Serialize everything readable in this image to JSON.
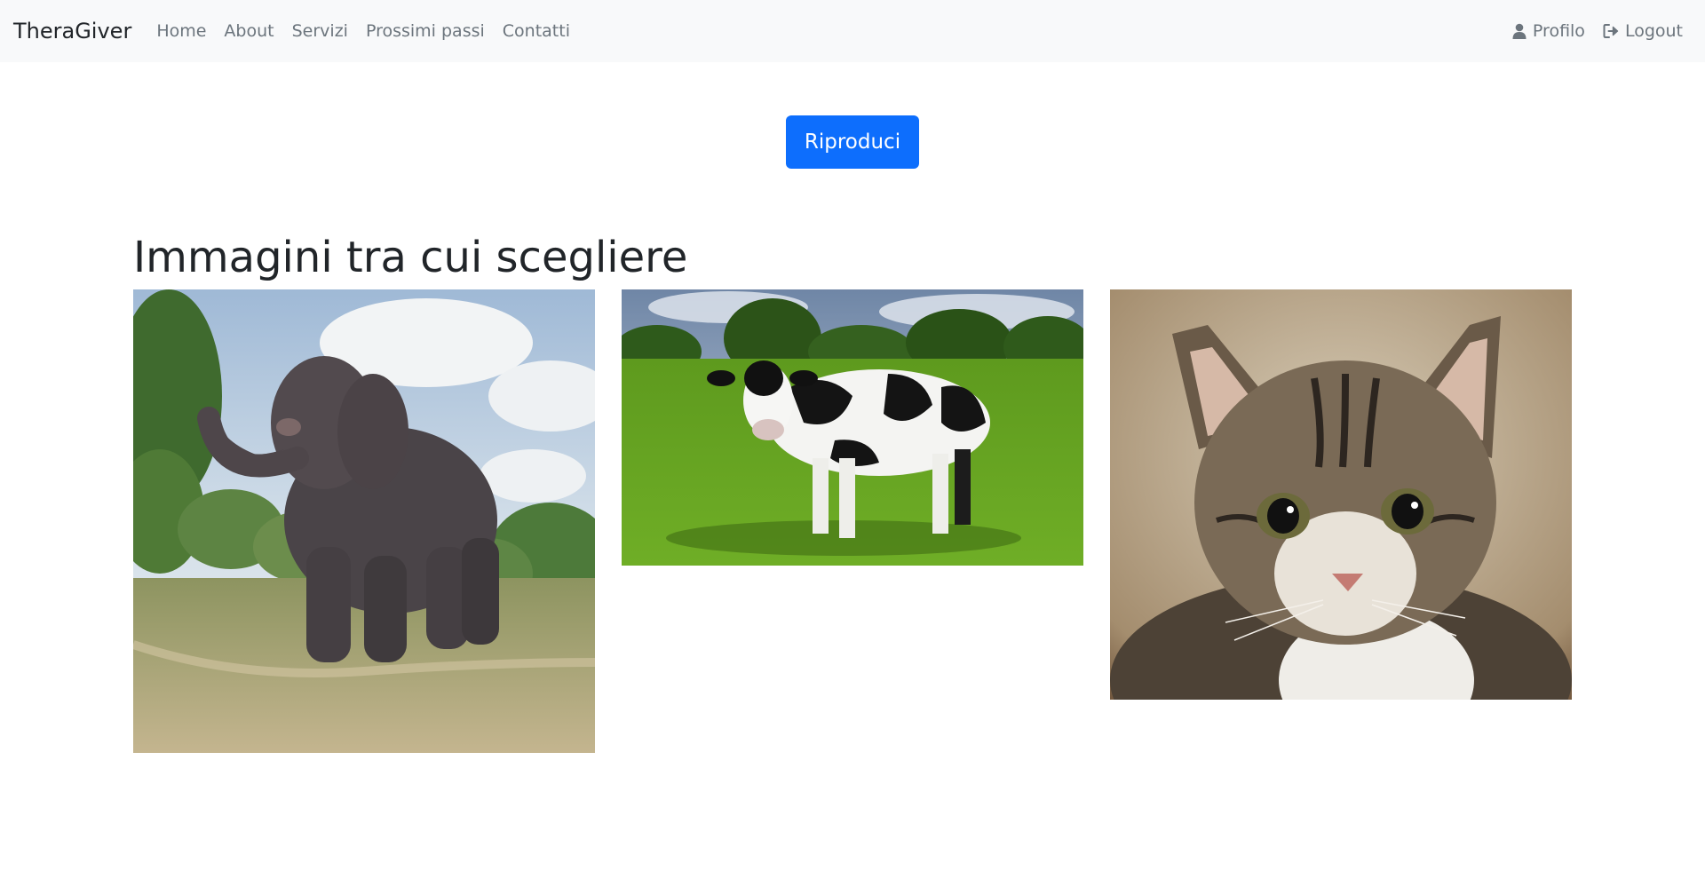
{
  "navbar": {
    "brand": "TheraGiver",
    "links": [
      "Home",
      "About",
      "Servizi",
      "Prossimi passi",
      "Contatti"
    ],
    "profile_label": "Profilo",
    "logout_label": "Logout"
  },
  "play_button_label": "Riproduci",
  "section_title": "Immagini tra cui scegliere",
  "images": [
    {
      "subject": "elephant",
      "alt": "elephant"
    },
    {
      "subject": "cow",
      "alt": "cow"
    },
    {
      "subject": "cat",
      "alt": "cat"
    }
  ],
  "colors": {
    "primary": "#0d6efd",
    "navbar_bg": "#f8f9fa",
    "nav_link": "#6c757d"
  }
}
